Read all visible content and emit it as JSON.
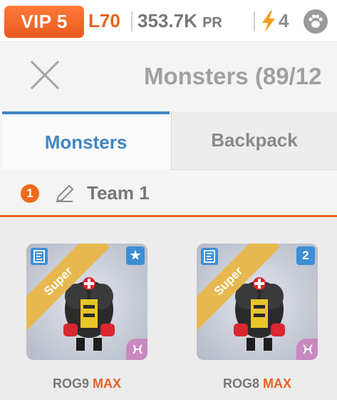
{
  "status_bar": {
    "vip": "VIP 5",
    "level": "L70",
    "power": "353.7K",
    "power_unit": "PR",
    "energy": "4"
  },
  "header": {
    "title": "Monsters (89/12"
  },
  "tabs": [
    {
      "label": "Monsters",
      "active": true
    },
    {
      "label": "Backpack",
      "active": false
    }
  ],
  "team": {
    "number": "1",
    "name": "Team 1"
  },
  "cards": [
    {
      "ribbon": "Super",
      "badge": "★",
      "name": "ROG9",
      "tag": "MAX"
    },
    {
      "ribbon": "Super",
      "badge": "2",
      "name": "ROG8",
      "tag": "MAX"
    }
  ],
  "icons": {
    "energy": "lightning-icon",
    "pet": "paw-icon",
    "close": "close-icon",
    "edit": "pencil-icon",
    "card_type": "e-box-icon",
    "zodiac": "pisces-icon"
  },
  "colors": {
    "accent": "#e8611e",
    "tab_active": "#3f86c2",
    "ribbon": "#e6b84f"
  }
}
